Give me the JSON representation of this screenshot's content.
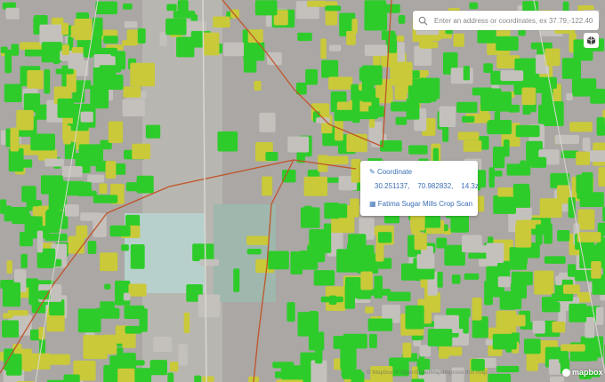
{
  "search": {
    "placeholder": "Enter an address or coordinates, ex 37.79,-122.40",
    "icon": "search-icon"
  },
  "controls": {
    "compass_icon": "compass-icon"
  },
  "popup": {
    "coordinate_label": "Coordinate",
    "lat": "30.251137,",
    "lng": "70.982832,",
    "zoom": "14.3z",
    "layer_name": "Fatima Sugar Mills Crop Scan"
  },
  "attribution": {
    "text": "© Mapbox © OpenStreetMap Improve this map",
    "logo": "mapbox"
  },
  "colors": {
    "crop_healthy": "#2ecc2a",
    "crop_stressed": "#c9c93a",
    "road": "#c0552a",
    "accent": "#3b6fb5"
  }
}
